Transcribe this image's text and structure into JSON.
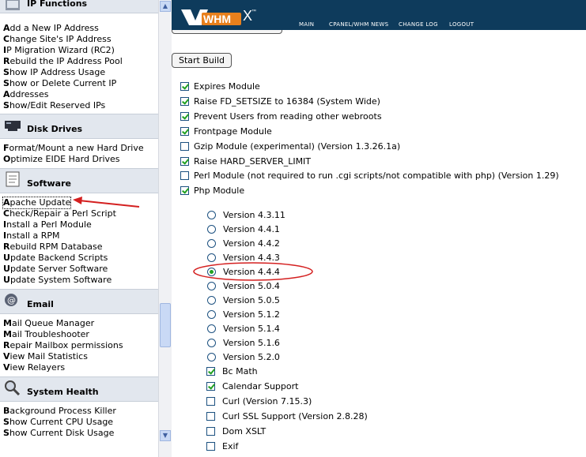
{
  "nav": {
    "sections": [
      {
        "title": "IP Functions",
        "icon": "ip-functions-icon",
        "links": [
          "Add a New IP Address",
          "Change Site's IP Address",
          "IP Migration Wizard (RC2)",
          "Rebuild the IP Address Pool",
          "Show IP Address Usage",
          "Show or Delete Current IP",
          "Addresses",
          "Show/Edit Reserved IPs"
        ]
      },
      {
        "title": "Disk Drives",
        "icon": "disk-drives-icon",
        "links": [
          "Format/Mount a new Hard Drive",
          "Optimize EIDE Hard Drives"
        ]
      },
      {
        "title": "Software",
        "icon": "software-icon",
        "links": [
          "Apache Update",
          "Check/Repair a Perl Script",
          "Install a Perl Module",
          "Install a RPM",
          "Rebuild RPM Database",
          "Update Backend Scripts",
          "Update Server Software",
          "Update System Software"
        ]
      },
      {
        "title": "Email",
        "icon": "email-icon",
        "links": [
          "Mail Queue Manager",
          "Mail Troubleshooter",
          "Repair Mailbox permissions",
          "View Mail Statistics",
          "View Relayers"
        ]
      },
      {
        "title": "System Health",
        "icon": "system-health-icon",
        "links": [
          "Background Process Killer",
          "Show Current CPU Usage",
          "Show Current Disk Usage"
        ]
      }
    ]
  },
  "header": {
    "logo_text": "WHM",
    "logo_suffix": "X",
    "menu": [
      "MAIN",
      "CPANEL/WHM NEWS",
      "CHANGE LOG",
      "LOGOUT"
    ]
  },
  "content": {
    "start_build_label": "Start Build",
    "modules": [
      {
        "label": "Expires Module",
        "checked": true
      },
      {
        "label": "Raise FD_SETSIZE to 16384 (System Wide)",
        "checked": true
      },
      {
        "label": "Prevent Users from reading other webroots",
        "checked": true
      },
      {
        "label": "Frontpage Module",
        "checked": true
      },
      {
        "label": "Gzip Module (experimental) (Version 1.3.26.1a)",
        "checked": false
      },
      {
        "label": "Raise HARD_SERVER_LIMIT",
        "checked": true
      },
      {
        "label": "Perl Module (not required to run .cgi scripts/not compatible with php) (Version 1.29)",
        "checked": false
      },
      {
        "label": "Php Module",
        "checked": true
      }
    ],
    "php_versions": [
      {
        "label": "Version 4.3.11",
        "selected": false
      },
      {
        "label": "Version 4.4.1",
        "selected": false
      },
      {
        "label": "Version 4.4.2",
        "selected": false
      },
      {
        "label": "Version 4.4.3",
        "selected": false
      },
      {
        "label": "Version 4.4.4",
        "selected": true
      },
      {
        "label": "Version 5.0.4",
        "selected": false
      },
      {
        "label": "Version 5.0.5",
        "selected": false
      },
      {
        "label": "Version 5.1.2",
        "selected": false
      },
      {
        "label": "Version 5.1.4",
        "selected": false
      },
      {
        "label": "Version 5.1.6",
        "selected": false
      },
      {
        "label": "Version 5.2.0",
        "selected": false
      }
    ],
    "php_options": [
      {
        "label": "Bc Math",
        "checked": true
      },
      {
        "label": "Calendar Support",
        "checked": true
      },
      {
        "label": "Curl (Version 7.15.3)",
        "checked": false
      },
      {
        "label": "Curl SSL Support (Version 2.8.28)",
        "checked": false
      },
      {
        "label": "Dom XSLT",
        "checked": false
      },
      {
        "label": "Exif",
        "checked": false
      }
    ]
  },
  "colors": {
    "header_bg": "#0e3b5c",
    "section_bg": "#e2e7ee",
    "annotation_red": "#d42020",
    "check_green": "#21a121"
  }
}
